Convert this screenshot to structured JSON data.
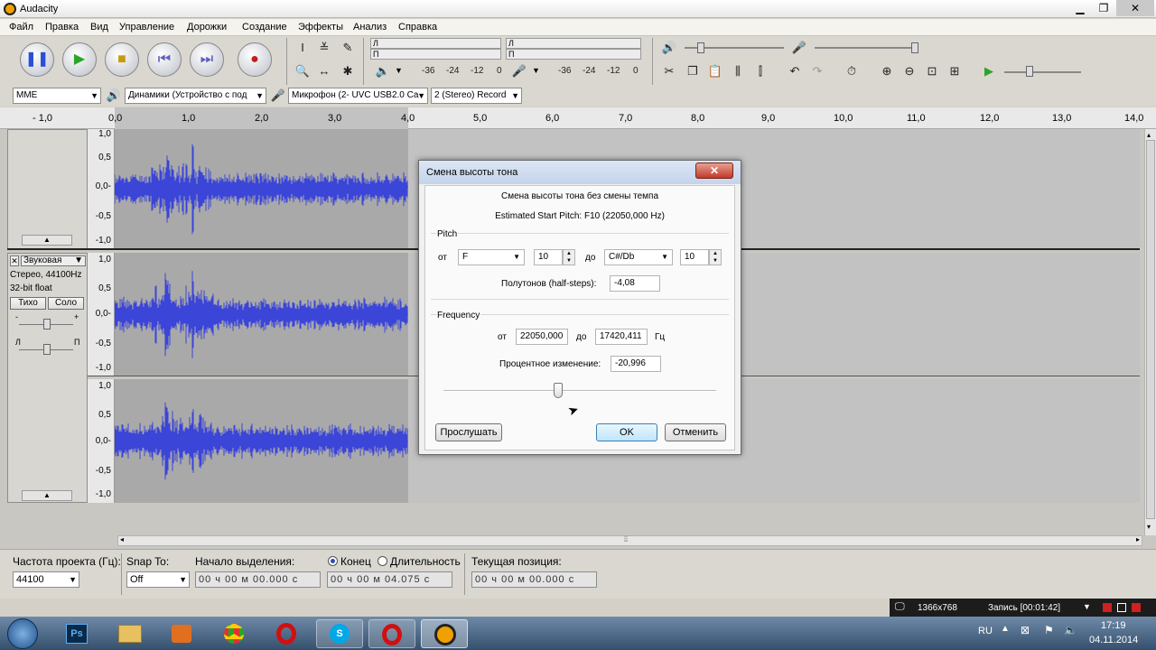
{
  "window": {
    "title": "Audacity",
    "minimize": "▁",
    "maximize": "❐",
    "close": "✕"
  },
  "menu": [
    "Файл",
    "Правка",
    "Вид",
    "Управление",
    "Дорожки",
    "Создание",
    "Эффекты",
    "Анализ",
    "Справка"
  ],
  "meters": {
    "play_l": "Л",
    "play_r": "П",
    "rec_l": "Л",
    "rec_r": "П",
    "ticks": [
      "-36",
      "-24",
      "-12",
      "0"
    ],
    "ticks2": [
      "-36",
      "-24",
      "-12",
      "0"
    ]
  },
  "device": {
    "host": "MME",
    "output": "Динамики (Устройство с под",
    "input": "Микрофон (2- UVC USB2.0 Ca",
    "channels": "2 (Stereo) Record"
  },
  "ruler": [
    "- 1,0",
    "0,0",
    "1,0",
    "2,0",
    "3,0",
    "4,0",
    "5,0",
    "6,0",
    "7,0",
    "8,0",
    "9,0",
    "10,0",
    "11,0",
    "12,0",
    "13,0",
    "14,0"
  ],
  "amplitude": [
    "1,0",
    "0,5",
    "0,0-",
    "-0,5",
    "-1,0"
  ],
  "track": {
    "name": "Звуковая",
    "info1": "Стерео, 44100Hz",
    "info2": "32-bit float",
    "mute": "Тихо",
    "solo": "Соло",
    "gain_minus": "-",
    "gain_plus": "+",
    "pan_l": "Л",
    "pan_r": "П"
  },
  "dialog": {
    "title": "Смена высоты тона",
    "heading": "Смена высоты тона без смены темпа",
    "estimated": "Estimated Start Pitch: F10 (22050,000 Hz)",
    "pitch_group": "Pitch",
    "from_label": "от",
    "from_note": "F",
    "from_octave": "10",
    "to_label": "до",
    "to_note": "C#/Db",
    "to_octave": "10",
    "semitones_label": "Полутонов (half-steps):",
    "semitones_value": "-4,08",
    "freq_group": "Frequency",
    "freq_from_label": "от",
    "freq_from": "22050,000",
    "freq_to_label": "до",
    "freq_to": "17420,411",
    "freq_unit": "Гц",
    "percent_label": "Процентное изменение:",
    "percent_value": "-20,996",
    "slider_level": 0.42,
    "preview": "Прослушать",
    "ok": "OK",
    "cancel": "Отменить"
  },
  "statusbar": {
    "rate_label": "Частота проекта (Гц):",
    "rate_value": "44100",
    "snap_label": "Snap To:",
    "snap_value": "Off",
    "start_label": "Начало выделения:",
    "start_value": "00 ч 00 м 00.000 с",
    "end_label": "Конец",
    "length_label": "Длительность",
    "end_value": "00 ч 00 м 04.075 с",
    "pos_label": "Текущая позиция:",
    "pos_value": "00 ч 00 м 00.000 с"
  },
  "recorder": {
    "resolution": "1366x768",
    "status": "Запись [00:01:42]"
  },
  "tray": {
    "lang": "RU",
    "time": "17:19",
    "date": "04.11.2014"
  }
}
